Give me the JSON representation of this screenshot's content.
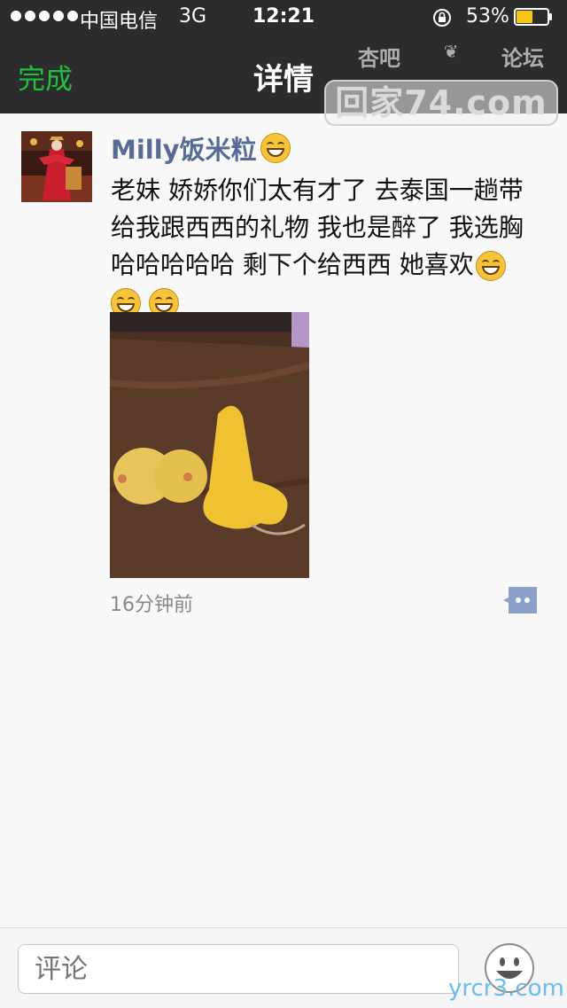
{
  "status_bar": {
    "carrier": "中国电信",
    "network": "3G",
    "time": "12:21",
    "battery_percent": "53%",
    "battery_level": 0.53
  },
  "nav": {
    "done_label": "完成",
    "title": "详情"
  },
  "watermark": {
    "top_left": "杏吧",
    "top_right": "论坛",
    "main": "回家74.com"
  },
  "post": {
    "author": "Milly饭米粒",
    "text_lines": [
      "老妹 娇娇你们太有才了 去泰国一趟带",
      "给我跟西西的礼物 我也是醉了 我选胸",
      " 哈哈哈哈哈 剩下个给西西 她喜欢"
    ],
    "time_ago": "16分钟前"
  },
  "bottom": {
    "comment_placeholder": "评论"
  },
  "site_watermark": "yrcr3.com",
  "colors": {
    "nav_bg": "#2c2c2e",
    "done_green": "#1fc13d",
    "author_blue": "#576b95"
  }
}
